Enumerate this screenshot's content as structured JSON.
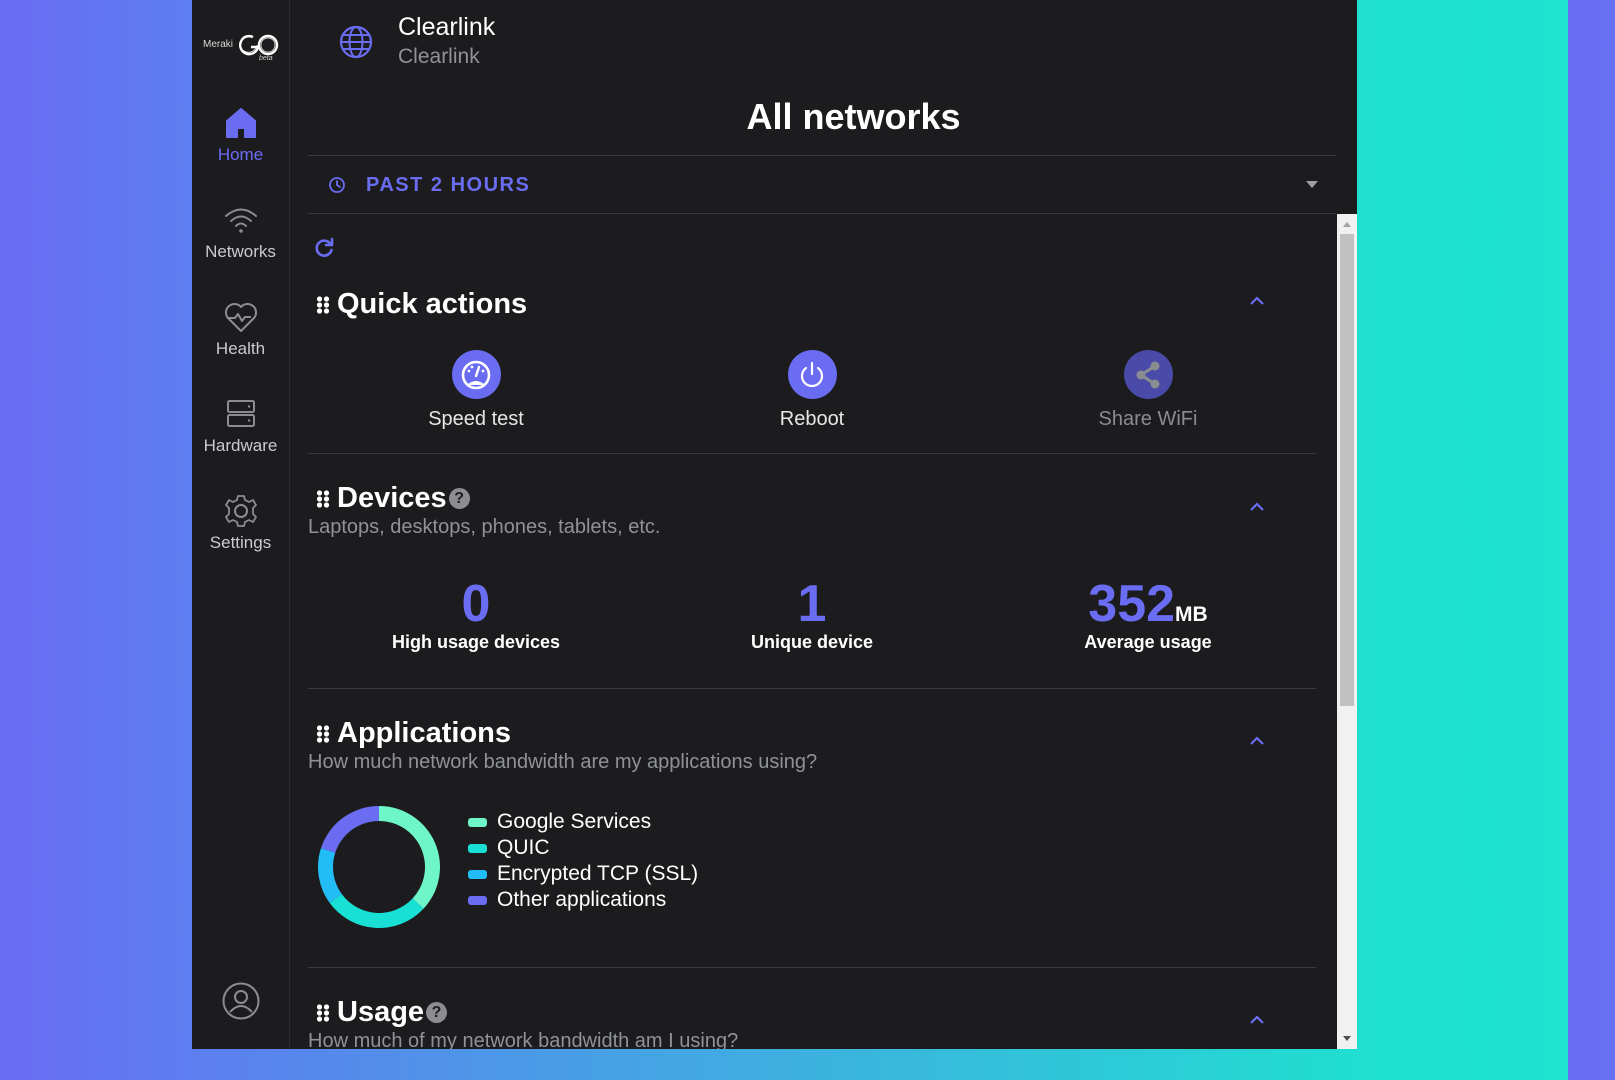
{
  "sidebar": {
    "logo": {
      "brand": "Meraki",
      "product": "GO",
      "tag": "beta"
    },
    "items": [
      {
        "label": "Home",
        "icon": "home-icon",
        "active": true
      },
      {
        "label": "Networks",
        "icon": "wifi-icon",
        "active": false
      },
      {
        "label": "Health",
        "icon": "heart-pulse-icon",
        "active": false
      },
      {
        "label": "Hardware",
        "icon": "server-icon",
        "active": false
      },
      {
        "label": "Settings",
        "icon": "gear-icon",
        "active": false
      }
    ],
    "profile_icon": "user-circle-icon"
  },
  "header": {
    "title": "Clearlink",
    "subtitle": "Clearlink",
    "icon": "globe-icon"
  },
  "page_title": "All networks",
  "time_filter": {
    "label": "PAST 2 HOURS",
    "icon": "clock-icon"
  },
  "colors": {
    "accent": "#6a6cf2",
    "background": "#1c1c1e",
    "muted_text": "#8f9297"
  },
  "quick_actions": {
    "title": "Quick actions",
    "items": [
      {
        "label": "Speed test",
        "icon": "speedometer-icon",
        "enabled": true
      },
      {
        "label": "Reboot",
        "icon": "power-icon",
        "enabled": true
      },
      {
        "label": "Share WiFi",
        "icon": "share-icon",
        "enabled": false
      }
    ]
  },
  "devices": {
    "title": "Devices",
    "subtitle": "Laptops, desktops, phones, tablets, etc.",
    "stats": [
      {
        "value": "0",
        "unit": "",
        "label": "High usage devices"
      },
      {
        "value": "1",
        "unit": "",
        "label": "Unique device"
      },
      {
        "value": "352",
        "unit": "MB",
        "label": "Average usage"
      }
    ]
  },
  "applications": {
    "title": "Applications",
    "subtitle": "How much network bandwidth are my applications using?"
  },
  "usage": {
    "title": "Usage",
    "subtitle": "How much of my network bandwidth am I using?"
  },
  "chart_data": {
    "type": "pie",
    "title": "Applications",
    "donut": true,
    "legend_position": "right",
    "categories": [
      "Google Services",
      "QUIC",
      "Encrypted TCP (SSL)",
      "Other applications"
    ],
    "values": [
      37,
      28,
      15,
      20
    ],
    "colors": [
      "#6ef5c8",
      "#18e0d4",
      "#22bdf7",
      "#6a6cf2"
    ]
  }
}
